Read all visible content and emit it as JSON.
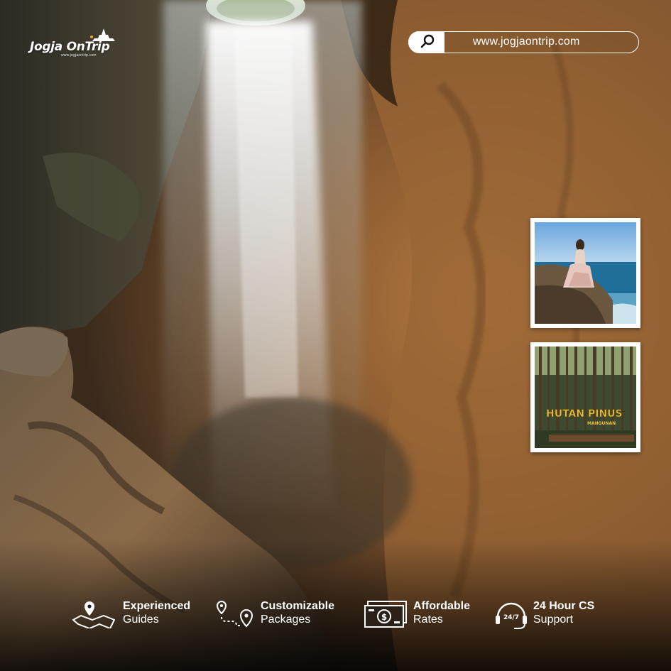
{
  "brand": {
    "logo_text": "Jogja OnTrip",
    "logo_tagline": "www.jogjaontrip.com"
  },
  "url_bar": {
    "icon": "search-icon",
    "text": "www.jogjaontrip.com"
  },
  "thumbnails": [
    {
      "scene": "woman seated on coastal rock overlooking the sea",
      "label": ""
    },
    {
      "scene": "pine forest with sign",
      "label": "HUTAN PINUS",
      "sublabel": "MANGUNAN"
    }
  ],
  "features": [
    {
      "icon": "map-pin-icon",
      "title": "Experienced",
      "subtitle": "Guides"
    },
    {
      "icon": "route-icon",
      "title": "Customizable",
      "subtitle": "Packages"
    },
    {
      "icon": "money-icon",
      "title": "Affordable",
      "subtitle": "Rates"
    },
    {
      "icon": "headset-24-7-icon",
      "title": "24 Hour CS",
      "subtitle": "Support",
      "badge": "24/7"
    }
  ],
  "colors": {
    "text": "#ffffff",
    "rock": "#8a5a30",
    "shadow": "#1d1710"
  }
}
